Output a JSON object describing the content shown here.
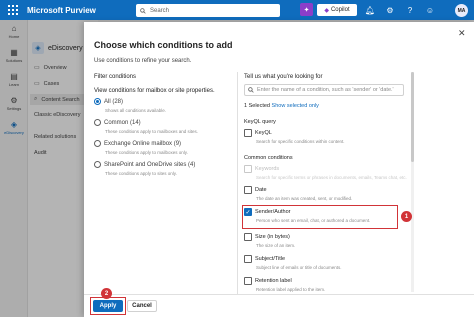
{
  "topbar": {
    "app_title": "Microsoft Purview",
    "search_placeholder": "Search",
    "copilot_label": "Copilot",
    "avatar_initials": "MA"
  },
  "rail": {
    "items": [
      {
        "label": "Home",
        "icon": "home-icon"
      },
      {
        "label": "Solutions",
        "icon": "grid-icon"
      },
      {
        "label": "Learn",
        "icon": "book-icon"
      },
      {
        "label": "Settings",
        "icon": "gear-icon"
      },
      {
        "label": "eDiscovery",
        "icon": "ediscovery-icon"
      }
    ]
  },
  "leftnav": {
    "header": "eDiscovery",
    "items": [
      "Overview",
      "Cases",
      "Content Search",
      "Classic eDiscovery"
    ],
    "section_title": "Related solutions",
    "section_items": [
      "Audit"
    ]
  },
  "panel": {
    "title": "Choose which conditions to add",
    "description": "Use conditions to refine your search.",
    "filter_conditions": "Filter conditions",
    "view_conditions": "View conditions for mailbox or site properties.",
    "radios": [
      {
        "label": "All (28)",
        "desc": "Shows all conditions available.",
        "checked": true
      },
      {
        "label": "Common (14)",
        "desc": "These conditions apply to mailboxes and sites.",
        "checked": false
      },
      {
        "label": "Exchange Online mailbox (9)",
        "desc": "These conditions apply to mailboxes only.",
        "checked": false
      },
      {
        "label": "SharePoint and OneDrive sites (4)",
        "desc": "These conditions apply to sites only.",
        "checked": false
      }
    ],
    "right_title": "Tell us what you're looking for",
    "search_placeholder": "Enter the name of a condition, such as 'sender' or 'date.'",
    "selected_count": "1 Selected",
    "show_selected": "Show selected only",
    "keyql_section": "KeyQL query",
    "keyql": {
      "label": "KeyQL",
      "desc": "Search for specific conditions within content."
    },
    "common_section": "Common conditions",
    "conditions": [
      {
        "label": "Keywords",
        "desc": "Search for specific terms or phrases in documents, emails, Teams chat, etc.",
        "disabled": true,
        "checked": false
      },
      {
        "label": "Date",
        "desc": "The date an item was created, sent, or modified.",
        "disabled": false,
        "checked": false
      },
      {
        "label": "Sender/Author",
        "desc": "Person who sent an email, chat, or authored a document.",
        "disabled": false,
        "checked": true
      },
      {
        "label": "Size (in bytes)",
        "desc": "The size of an item.",
        "disabled": false,
        "checked": false
      },
      {
        "label": "Subject/Title",
        "desc": "Subject line of emails or title of documents.",
        "disabled": false,
        "checked": false
      },
      {
        "label": "Retention label",
        "desc": "Retention label applied to the item.",
        "disabled": false,
        "checked": false
      }
    ],
    "apply_label": "Apply",
    "cancel_label": "Cancel",
    "badge1": "1",
    "badge2": "2"
  },
  "colors": {
    "brand": "#0f6cbd",
    "highlight": "#d13438",
    "copilot": "#8b3ec9"
  }
}
